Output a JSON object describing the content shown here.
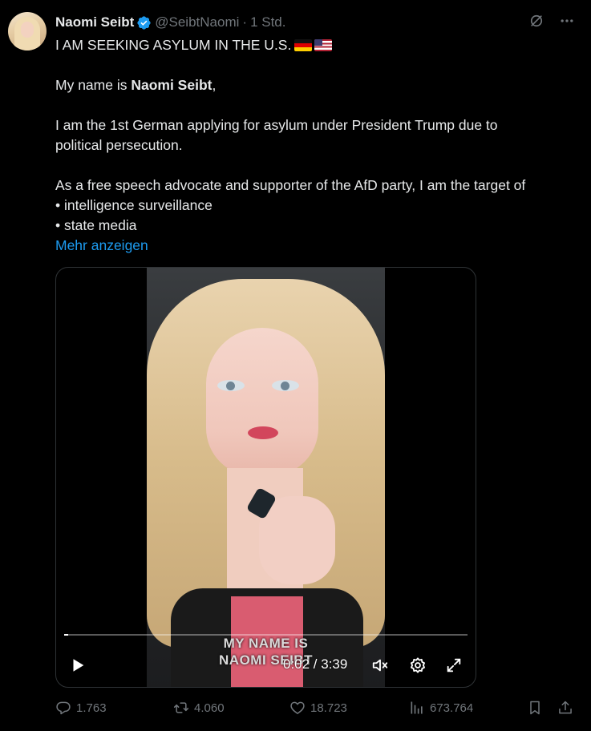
{
  "author": {
    "name": "Naomi Seibt",
    "handle": "@SeibtNaomi",
    "separator": "·",
    "time": "1 Std."
  },
  "icons": {
    "verified": "verified-badge-icon",
    "grok": "grok-icon",
    "more": "more-options-icon",
    "flags": [
      "germany-flag",
      "usa-flag"
    ]
  },
  "tweet": {
    "line1": "I AM SEEKING ASYLUM IN THE U.S.",
    "line2_prefix": "My name is ",
    "line2_bold": "Naomi Seibt",
    "line2_suffix": ",",
    "line3": "I am the 1st German applying for asylum under President Trump due to",
    "line4": "political persecution.",
    "line5": "As a free speech advocate and supporter of the AfD party, I am the target of",
    "line6": "• intelligence surveillance",
    "line7": "• state media",
    "show_more": "Mehr anzeigen"
  },
  "video": {
    "caption_line1": "MY NAME IS",
    "caption_line2": "NAOMI SEIBT",
    "time": "0:02 / 3:39",
    "progress": 0.009
  },
  "actions": {
    "replies": "1.763",
    "reposts": "4.060",
    "likes": "18.723",
    "views": "673.764"
  },
  "colors": {
    "background": "#000000",
    "text": "#e7e9ea",
    "muted": "#71767b",
    "link": "#1d9bf0",
    "verified": "#1d9bf0"
  }
}
